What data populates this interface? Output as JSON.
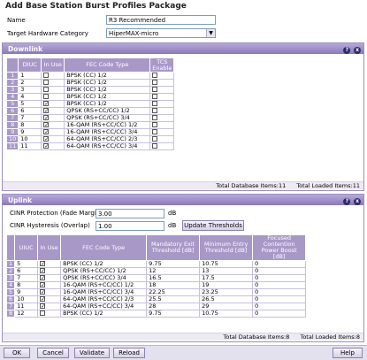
{
  "page": {
    "title": "Add Base Station Burst Profiles Package",
    "name_label": "Name",
    "name_value": "R3 Recommended",
    "category_label": "Target Hardware Category",
    "category_value": "HiperMAX-micro"
  },
  "downlink": {
    "title": "Downlink",
    "headers": [
      "DIUC",
      "In Use",
      "FEC Code Type",
      "TCS Enable"
    ],
    "rows": [
      {
        "n": "1",
        "code": "1",
        "inuse": false,
        "fec": "BPSK (CC) 1/2",
        "tcs": false
      },
      {
        "n": "2",
        "code": "2",
        "inuse": false,
        "fec": "BPSK (CC) 1/2",
        "tcs": false
      },
      {
        "n": "3",
        "code": "3",
        "inuse": false,
        "fec": "BPSK (CC) 1/2",
        "tcs": false
      },
      {
        "n": "4",
        "code": "4",
        "inuse": false,
        "fec": "BPSK (CC) 1/2",
        "tcs": false
      },
      {
        "n": "5",
        "code": "5",
        "inuse": true,
        "fec": "BPSK (CC) 1/2",
        "tcs": false
      },
      {
        "n": "6",
        "code": "6",
        "inuse": true,
        "fec": "QPSK (RS+CC/CC) 1/2",
        "tcs": false
      },
      {
        "n": "7",
        "code": "7",
        "inuse": true,
        "fec": "QPSK (RS+CC/CC) 3/4",
        "tcs": false
      },
      {
        "n": "8",
        "code": "8",
        "inuse": true,
        "fec": "16-QAM (RS+CC/CC) 1/2",
        "tcs": false
      },
      {
        "n": "9",
        "code": "9",
        "inuse": true,
        "fec": "16-QAM (RS+CC/CC) 3/4",
        "tcs": false
      },
      {
        "n": "10",
        "code": "10",
        "inuse": true,
        "fec": "64-QAM (RS+CC/CC) 2/3",
        "tcs": false
      },
      {
        "n": "11",
        "code": "11",
        "inuse": true,
        "fec": "64-QAM (RS+CC/CC) 3/4",
        "tcs": false
      }
    ],
    "total_db": "Total Database Items:11",
    "total_loaded": "Total Loaded Items:11"
  },
  "uplink": {
    "title": "Uplink",
    "cinr_protection_label": "CINR Protection (Fade Margin)",
    "cinr_protection_value": "3.00",
    "cinr_hysteresis_label": "CINR Hysteresis (Overlap)",
    "cinr_hysteresis_value": "1.00",
    "unit": "dB",
    "update_button": "Update Thresholds",
    "headers": [
      "UIUC",
      "In Use",
      "FEC Code Type",
      "Mandatory Exit Threshold [dB]",
      "Minimum Entry Threshold [dB]",
      "Focused Contention Power Boost [dB]"
    ],
    "rows": [
      {
        "n": "1",
        "code": "5",
        "inuse": true,
        "fec": "BPSK (CC) 1/2",
        "exit": "9.75",
        "entry": "10.75",
        "boost": "0"
      },
      {
        "n": "2",
        "code": "6",
        "inuse": true,
        "fec": "QPSK (RS+CC/CC) 1/2",
        "exit": "12",
        "entry": "13",
        "boost": "0"
      },
      {
        "n": "3",
        "code": "7",
        "inuse": true,
        "fec": "QPSK (RS+CC/CC) 3/4",
        "exit": "16.5",
        "entry": "17.5",
        "boost": "0"
      },
      {
        "n": "4",
        "code": "8",
        "inuse": true,
        "fec": "16-QAM (RS+CC/CC) 1/2",
        "exit": "18",
        "entry": "19",
        "boost": "0"
      },
      {
        "n": "5",
        "code": "9",
        "inuse": true,
        "fec": "16-QAM (RS+CC/CC) 3/4",
        "exit": "22.25",
        "entry": "23.25",
        "boost": "0"
      },
      {
        "n": "6",
        "code": "10",
        "inuse": true,
        "fec": "64-QAM (RS+CC/CC) 2/3",
        "exit": "25.5",
        "entry": "26.5",
        "boost": "0"
      },
      {
        "n": "7",
        "code": "11",
        "inuse": true,
        "fec": "64-QAM (RS+CC/CC) 3/4",
        "exit": "28",
        "entry": "29",
        "boost": "0"
      },
      {
        "n": "8",
        "code": "12",
        "inuse": false,
        "fec": "BPSK (CC) 1/2",
        "exit": "9.75",
        "entry": "10.75",
        "boost": "0"
      }
    ],
    "total_db": "Total Database Items:8",
    "total_loaded": "Total Loaded Items:8"
  },
  "buttons": {
    "ok": "OK",
    "cancel": "Cancel",
    "validate": "Validate",
    "reload": "Reload",
    "help": "Help"
  },
  "icons": {
    "panel_help": "?",
    "panel_close": "x",
    "dropdown": "▼",
    "check": "✓"
  }
}
